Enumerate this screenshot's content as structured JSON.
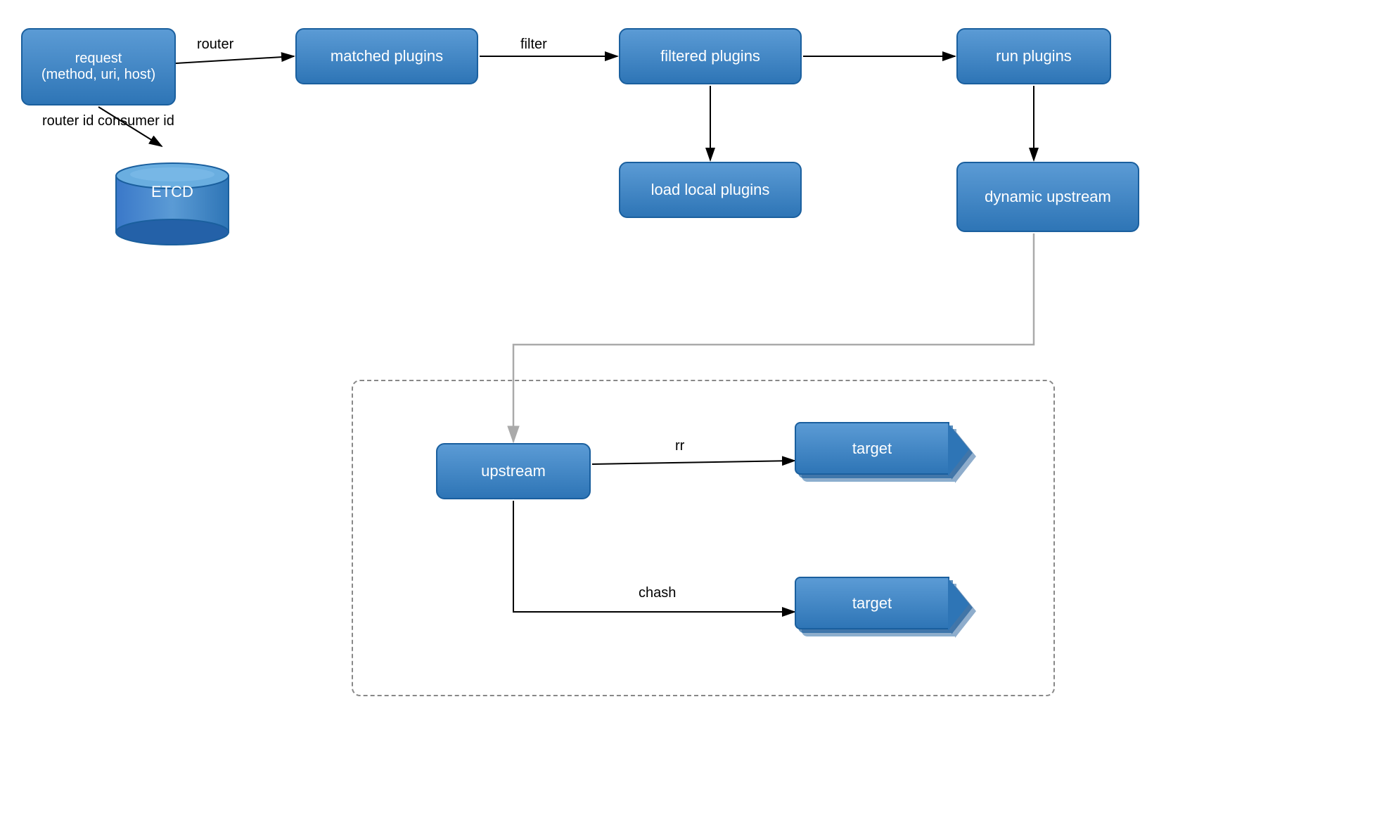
{
  "nodes": {
    "request": {
      "label": "request\n(method, uri, host)"
    },
    "matched": {
      "label": "matched plugins"
    },
    "filtered": {
      "label": "filtered plugins"
    },
    "run": {
      "label": "run plugins"
    },
    "load_local": {
      "label": "load local plugins"
    },
    "dynamic": {
      "label": "dynamic upstream"
    },
    "upstream": {
      "label": "upstream"
    },
    "target1": {
      "label": "target"
    },
    "target2": {
      "label": "target"
    },
    "etcd": {
      "label": "ETCD"
    }
  },
  "labels": {
    "router": "router",
    "router_id": "router id\nconsumer id",
    "filter": "filter",
    "rr": "rr",
    "chash": "chash"
  },
  "colors": {
    "node_gradient_top": "#5b9bd5",
    "node_gradient_bottom": "#2e75b6",
    "border": "#1a5f9e",
    "text": "#ffffff",
    "arrow": "#000000",
    "arrow_gray": "#aaaaaa"
  }
}
